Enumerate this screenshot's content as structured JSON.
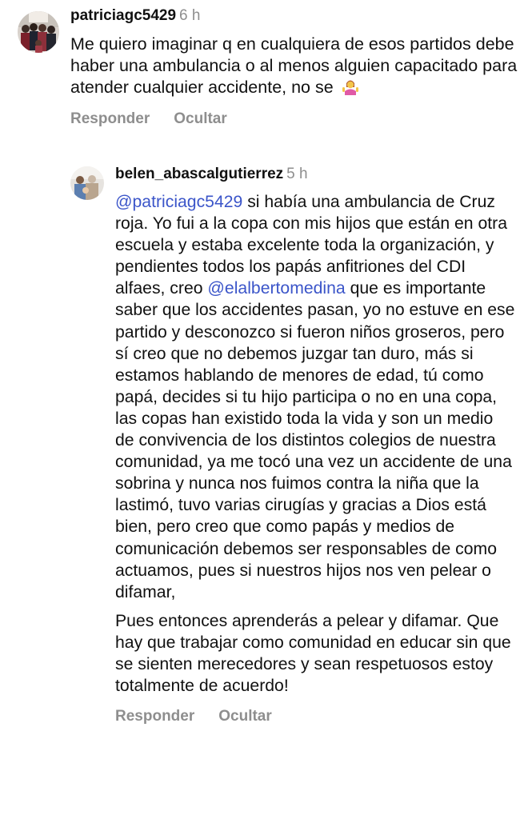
{
  "comments": [
    {
      "username": "patriciagc5429",
      "time": "6 h",
      "text": "Me quiero imaginar q en cualquiera de esos partidos debe haber una ambulancia o al menos alguien capacitado para atender cualquier accidente, no se",
      "emoji": "person-shrugging-emoji",
      "reply_label": "Responder",
      "hide_label": "Ocultar"
    },
    {
      "username": "belen_abascalgutierrez",
      "time": "5 h",
      "mention1": "@patriciagc5429",
      "text_a": " si había una ambulancia de Cruz roja. Yo fui a la copa con mis hijos que están en otra escuela y estaba excelente toda la organización, y pendientes todos los papás anfitriones del CDI alfaes, creo ",
      "mention2": "@elalbertomedina",
      "text_b": " que es importante saber que los accidentes pasan, yo no estuve en ese partido y desconozco si fueron niños groseros, pero sí creo que no debemos juzgar tan duro, más si estamos hablando de menores de edad, tú como papá, decides si tu hijo participa o no en una copa, las copas han existido toda la vida y son un medio de convivencia de los distintos colegios de nuestra comunidad, ya me tocó una vez un accidente de una sobrina y nunca nos fuimos contra la niña que la lastimó, tuvo varias cirugías y gracias a Dios está bien, pero creo que como papás y medios de comunicación debemos ser responsables de como actuamos, pues si nuestros hijos nos ven pelear o difamar,",
      "text_c": "Pues entonces aprenderás a pelear y difamar. Que hay que trabajar como comunidad en educar sin que se sienten merecedores y sean respetuosos estoy totalmente de acuerdo!",
      "reply_label": "Responder",
      "hide_label": "Ocultar"
    }
  ],
  "colors": {
    "mention": "#3b55c9",
    "muted": "#8e8e8e",
    "text": "#111111"
  }
}
